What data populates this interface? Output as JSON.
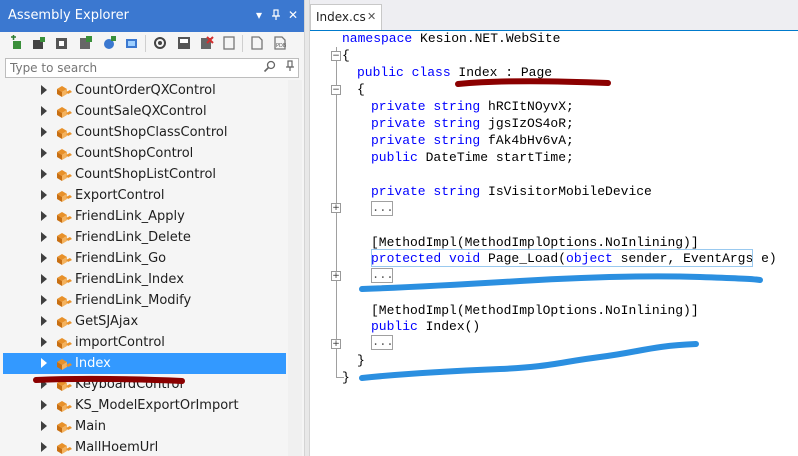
{
  "explorer": {
    "title": "Assembly Explorer",
    "search_placeholder": "Type to search",
    "items": [
      {
        "label": "CountOrderQXControl",
        "selected": false
      },
      {
        "label": "CountSaleQXControl",
        "selected": false
      },
      {
        "label": "CountShopClassControl",
        "selected": false
      },
      {
        "label": "CountShopControl",
        "selected": false
      },
      {
        "label": "CountShopListControl",
        "selected": false
      },
      {
        "label": "ExportControl",
        "selected": false
      },
      {
        "label": "FriendLink_Apply",
        "selected": false
      },
      {
        "label": "FriendLink_Delete",
        "selected": false
      },
      {
        "label": "FriendLink_Go",
        "selected": false
      },
      {
        "label": "FriendLink_Index",
        "selected": false
      },
      {
        "label": "FriendLink_Modify",
        "selected": false
      },
      {
        "label": "GetSJAjax",
        "selected": false
      },
      {
        "label": "importControl",
        "selected": false
      },
      {
        "label": "Index",
        "selected": true
      },
      {
        "label": "KeyboardControl",
        "selected": false
      },
      {
        "label": "KS_ModelExportOrImport",
        "selected": false
      },
      {
        "label": "Main",
        "selected": false
      },
      {
        "label": "MallHoemUrl",
        "selected": false
      }
    ],
    "selection_color": "#3399ff",
    "title_bg": "#3b78d0"
  },
  "editor": {
    "tab_label": "Index.cs",
    "tab_close": "✕",
    "code": {
      "ns_kw": "namespace",
      "ns_name": " Kesion.NET.WebSite",
      "brace_open": "{",
      "class_kw": "public class",
      "class_name": " Index : Page",
      "f1_kw": "private string",
      "f1_name": " hRCItNOyvX;",
      "f2_kw": "private string",
      "f2_name": " jgsIzOS4oR;",
      "f3_kw": "private string",
      "f3_name": " fAk4bHv6vA;",
      "f4_kw": "public",
      "f4_name": " DateTime startTime;",
      "m1_kw": "private string",
      "m1_name": " IsVisitorMobileDevice",
      "collapsed": "...",
      "attr1": "[MethodImpl(MethodImplOptions.NoInlining)]",
      "pl_kw1": "protected void",
      "pl_mid": " Page_Load(",
      "pl_kw2": "object",
      "pl_end": " sender, EventArgs e)",
      "attr2": "[MethodImpl(MethodImplOptions.NoInlining)]",
      "ctor_kw": "public",
      "ctor_name": " Index()",
      "brace_close": "}"
    },
    "keyword_color": "#0000ff",
    "annotation_red": "#8b0000",
    "annotation_blue": "#2b8fe0"
  }
}
